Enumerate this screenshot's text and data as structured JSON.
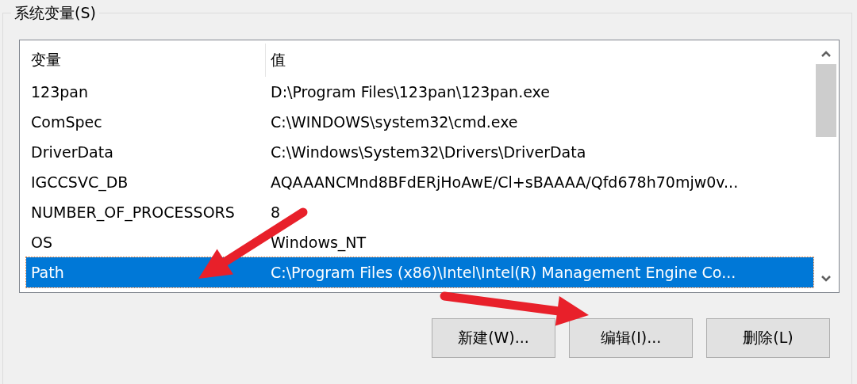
{
  "group": {
    "title": "系统变量(S)"
  },
  "table": {
    "columns": [
      "变量",
      "值"
    ],
    "rows": [
      {
        "cells": [
          "123pan",
          "D:\\Program Files\\123pan\\123pan.exe"
        ],
        "selected": false
      },
      {
        "cells": [
          "ComSpec",
          "C:\\WINDOWS\\system32\\cmd.exe"
        ],
        "selected": false
      },
      {
        "cells": [
          "DriverData",
          "C:\\Windows\\System32\\Drivers\\DriverData"
        ],
        "selected": false
      },
      {
        "cells": [
          "IGCCSVC_DB",
          "AQAAANCMnd8BFdERjHoAwE/Cl+sBAAAA/Qfd678h70mjw0v..."
        ],
        "selected": false
      },
      {
        "cells": [
          "NUMBER_OF_PROCESSORS",
          "8"
        ],
        "selected": false
      },
      {
        "cells": [
          "OS",
          "Windows_NT"
        ],
        "selected": false
      },
      {
        "cells": [
          "Path",
          "C:\\Program Files (x86)\\Intel\\Intel(R) Management Engine Co..."
        ],
        "selected": true
      }
    ]
  },
  "buttons": [
    "新建(W)...",
    "编辑(I)...",
    "删除(L)"
  ]
}
